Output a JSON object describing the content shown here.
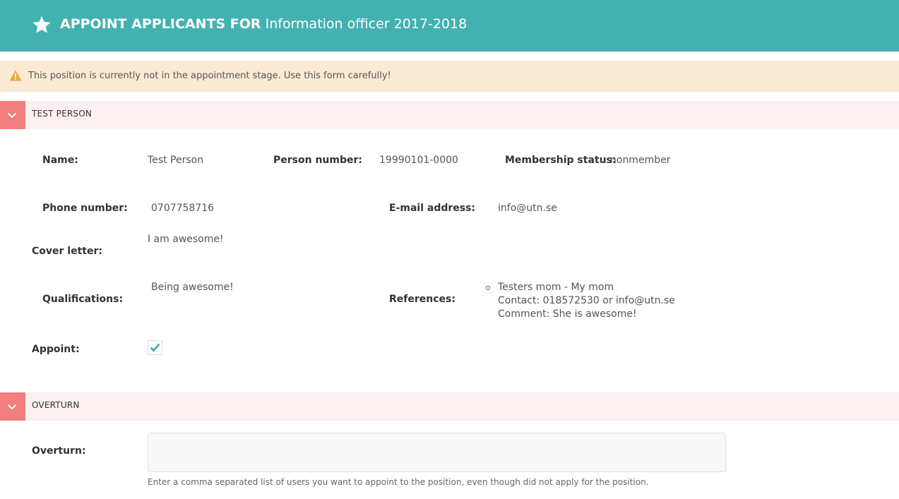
{
  "header": {
    "prefix": "APPOINT APPLICANTS FOR",
    "position": "Information officer 2017-2018",
    "icon": "star-icon"
  },
  "warning": {
    "text": "This position is currently not in the appointment stage. Use this form carefully!",
    "icon": "warning-icon",
    "color": "#e7a93b"
  },
  "applicant": {
    "section_title": "TEST PERSON",
    "name_label": "Name:",
    "name": "Test Person",
    "person_number_label": "Person number:",
    "person_number": "19990101-0000",
    "membership_label": "Membership status:",
    "membership": "nonmember",
    "phone_label": "Phone number:",
    "phone": "0707758716",
    "email_label": "E-mail address:",
    "email": "info@utn.se",
    "cover_letter_label": "Cover letter:",
    "cover_letter": "I am awesome!",
    "qualifications_label": "Qualifications:",
    "qualifications": "Being awesome!",
    "references_label": "References:",
    "references": [
      {
        "name_line": "Testers mom - My mom",
        "contact_line": "Contact: 018572530 or info@utn.se",
        "comment_line": "Comment: She is awesome!"
      }
    ],
    "appoint_label": "Appoint:",
    "appoint_checked": true
  },
  "overturn": {
    "section_title": "OVERTURN",
    "label": "Overturn:",
    "value": "",
    "help": "Enter a comma separated list of users you want to appoint to the position, even though did not apply for the position."
  },
  "colors": {
    "header_bg": "#44b1b1",
    "warning_bg": "#fbebd4",
    "section_bg": "#fcf0f0",
    "toggle_bg": "#f07f7d",
    "check": "#44b1b1"
  }
}
